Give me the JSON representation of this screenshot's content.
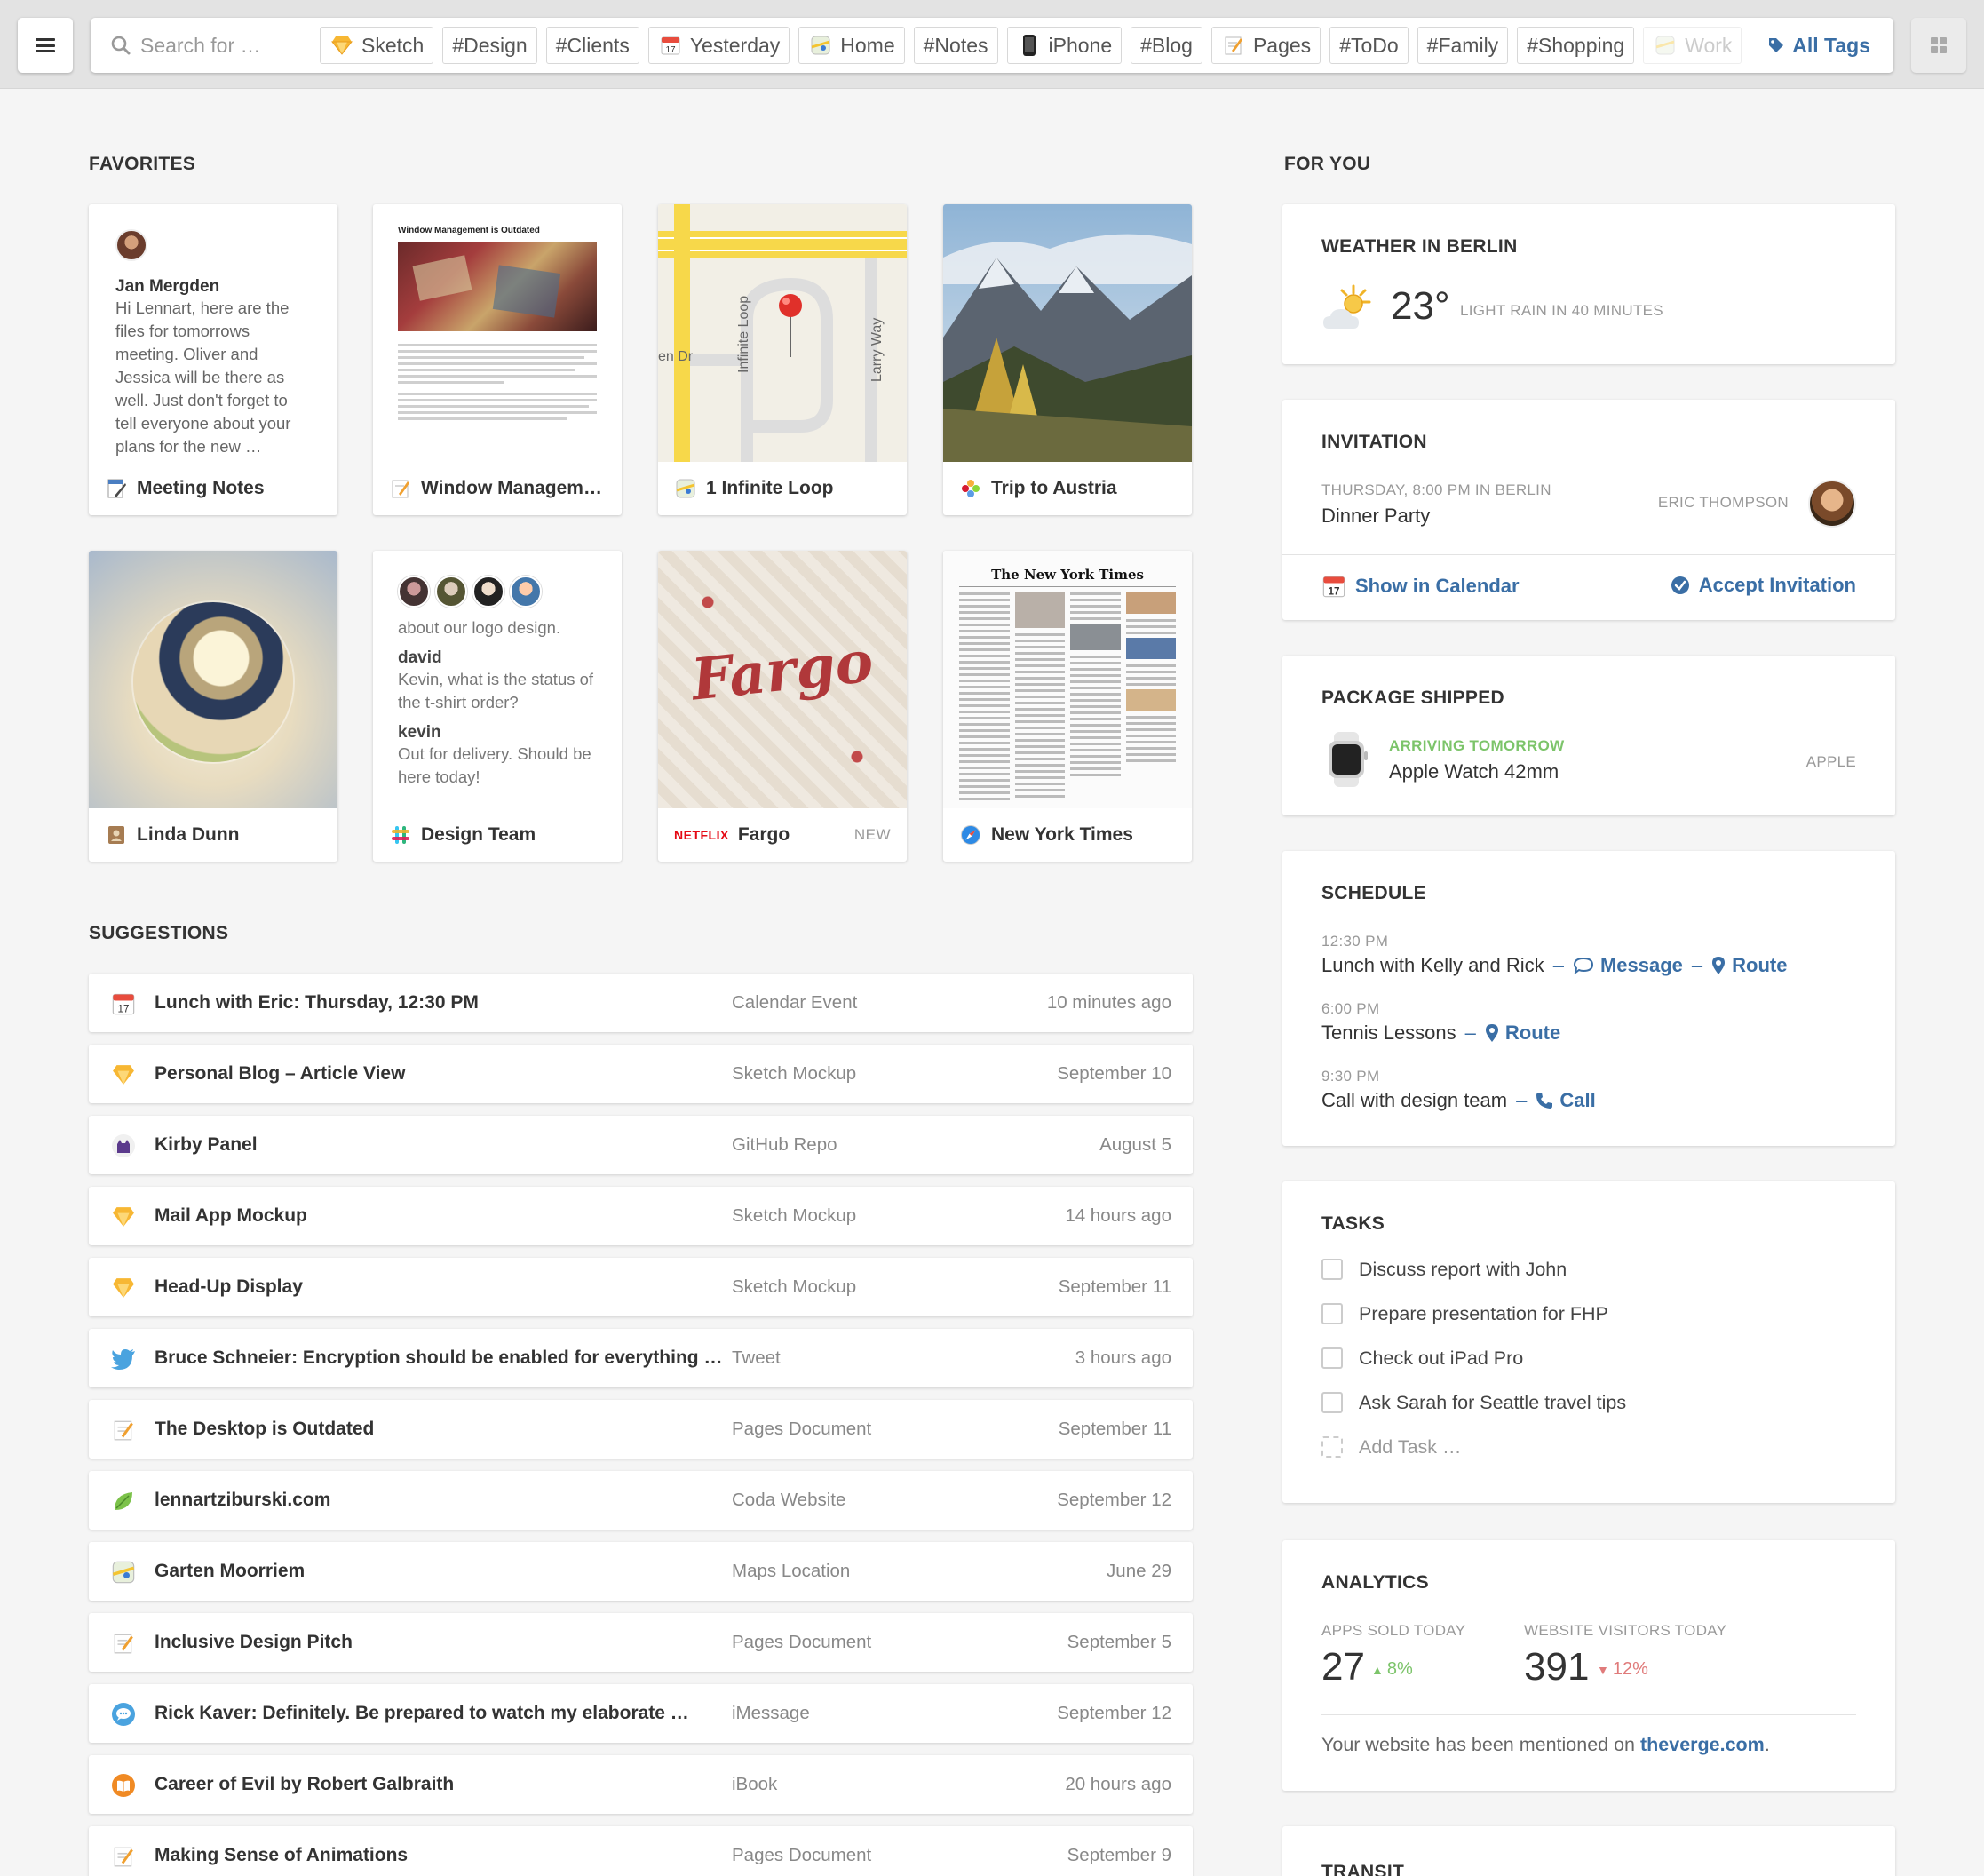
{
  "search": {
    "placeholder": "Search for …"
  },
  "tags": [
    {
      "label": "Sketch",
      "icon": "sketch-icon"
    },
    {
      "label": "#Design",
      "icon": ""
    },
    {
      "label": "#Clients",
      "icon": ""
    },
    {
      "label": "Yesterday",
      "icon": "calendar-icon"
    },
    {
      "label": "Home",
      "icon": "maps-icon"
    },
    {
      "label": "#Notes",
      "icon": ""
    },
    {
      "label": "iPhone",
      "icon": "iphone-icon"
    },
    {
      "label": "#Blog",
      "icon": ""
    },
    {
      "label": "Pages",
      "icon": "pages-icon"
    },
    {
      "label": "#ToDo",
      "icon": ""
    },
    {
      "label": "#Family",
      "icon": ""
    },
    {
      "label": "#Shopping",
      "icon": ""
    },
    {
      "label": "Work",
      "icon": "maps-icon"
    }
  ],
  "all_tags_label": "All Tags",
  "favorites": {
    "title": "FAVORITES",
    "cards": [
      {
        "label": "Meeting Notes",
        "from": "Jan Mergden",
        "text": "Hi Lennart, here are the files for tomorrows meeting. Oliver and Jessica will be there as well. Just don't forget to tell everyone about your plans for the new …"
      },
      {
        "label": "Window Manageme…",
        "doc_title": "Window Management is Outdated"
      },
      {
        "label": "1 Infinite Loop",
        "streets": [
          "Infinite Loop",
          "Larry Way",
          "en Dr"
        ]
      },
      {
        "label": "Trip to Austria"
      },
      {
        "label": "Linda Dunn"
      },
      {
        "label": "Design Team",
        "line1": "about our logo design.",
        "name1": "david",
        "msg1": "Kevin, what is the status of the t-shirt order?",
        "name2": "kevin",
        "msg2": "Out for delivery. Should be here today!"
      },
      {
        "label": "Fargo",
        "brand": "NETFLIX",
        "badge": "NEW",
        "art_word": "Fargo"
      },
      {
        "label": "New York Times",
        "masthead": "The New York Times"
      }
    ]
  },
  "suggestions": {
    "title": "SUGGESTIONS",
    "rows": [
      {
        "title": "Lunch with Eric: Thursday, 12:30 PM",
        "type": "Calendar Event",
        "time": "10 minutes ago",
        "icon": "calendar-icon"
      },
      {
        "title": "Personal Blog – Article View",
        "type": "Sketch Mockup",
        "time": "September 10",
        "icon": "sketch-icon"
      },
      {
        "title": "Kirby Panel",
        "type": "GitHub Repo",
        "time": "August 5",
        "icon": "github-icon"
      },
      {
        "title": "Mail App Mockup",
        "type": "Sketch Mockup",
        "time": "14 hours ago",
        "icon": "sketch-icon"
      },
      {
        "title": "Head-Up Display",
        "type": "Sketch Mockup",
        "time": "September 11",
        "icon": "sketch-icon"
      },
      {
        "title": "Bruce Schneier: Encryption should be enabled for everything …",
        "type": "Tweet",
        "time": "3 hours ago",
        "icon": "twitter-icon"
      },
      {
        "title": "The Desktop is Outdated",
        "type": "Pages Document",
        "time": "September 11",
        "icon": "pages-icon"
      },
      {
        "title": "lennartziburski.com",
        "type": "Coda Website",
        "time": "September 12",
        "icon": "coda-icon"
      },
      {
        "title": "Garten Moorriem",
        "type": "Maps Location",
        "time": "June 29",
        "icon": "maps-icon"
      },
      {
        "title": "Inclusive Design Pitch",
        "type": "Pages Document",
        "time": "September 5",
        "icon": "pages-icon"
      },
      {
        "title": "Rick Kaver: Definitely. Be prepared to watch my elaborate …",
        "type": "iMessage",
        "time": "September 12",
        "icon": "imessage-icon"
      },
      {
        "title": "Career of Evil by Robert Galbraith",
        "type": "iBook",
        "time": "20 hours ago",
        "icon": "ibooks-icon"
      },
      {
        "title": "Making Sense of Animations",
        "type": "Pages Document",
        "time": "September 9",
        "icon": "pages-icon"
      }
    ]
  },
  "for_you": {
    "title": "FOR YOU",
    "weather": {
      "title": "WEATHER IN BERLIN",
      "temp": "23°",
      "note": "LIGHT RAIN IN 40 MINUTES"
    },
    "invitation": {
      "title": "INVITATION",
      "when": "THURSDAY, 8:00 PM IN BERLIN",
      "event": "Dinner Party",
      "host": "ERIC THOMPSON",
      "show_label": "Show in Calendar",
      "accept_label": "Accept Invitation"
    },
    "package": {
      "title": "PACKAGE SHIPPED",
      "status": "ARRIVING TOMORROW",
      "item": "Apple Watch 42mm",
      "vendor": "APPLE",
      "status_color": "#7cc46a"
    },
    "schedule": {
      "title": "SCHEDULE",
      "items": [
        {
          "time": "12:30 PM",
          "text": "Lunch with Kelly and Rick",
          "actions": [
            "Message",
            "Route"
          ]
        },
        {
          "time": "6:00 PM",
          "text": "Tennis Lessons",
          "actions": [
            "Route"
          ]
        },
        {
          "time": "9:30 PM",
          "text": "Call with design team",
          "actions": [
            "Call"
          ]
        }
      ]
    },
    "tasks": {
      "title": "TASKS",
      "items": [
        "Discuss report with John",
        "Prepare presentation for FHP",
        "Check out iPad Pro",
        "Ask Sarah for Seattle travel tips"
      ],
      "add_label": "Add Task …"
    },
    "analytics": {
      "title": "ANALYTICS",
      "apps_label": "APPS SOLD TODAY",
      "apps_value": "27",
      "apps_change": "8%",
      "visitors_label": "WEBSITE VISITORS TODAY",
      "visitors_value": "391",
      "visitors_change": "12%",
      "mention_prefix": "Your website has been mentioned on ",
      "mention_link": "theverge.com",
      "mention_suffix": ".",
      "up_color": "#7cc46a",
      "down_color": "#e07b7b"
    },
    "transit": {
      "title": "TRANSIT"
    }
  },
  "colors": {
    "accent": "#3a6ea5",
    "background": "#f5f5f5"
  }
}
